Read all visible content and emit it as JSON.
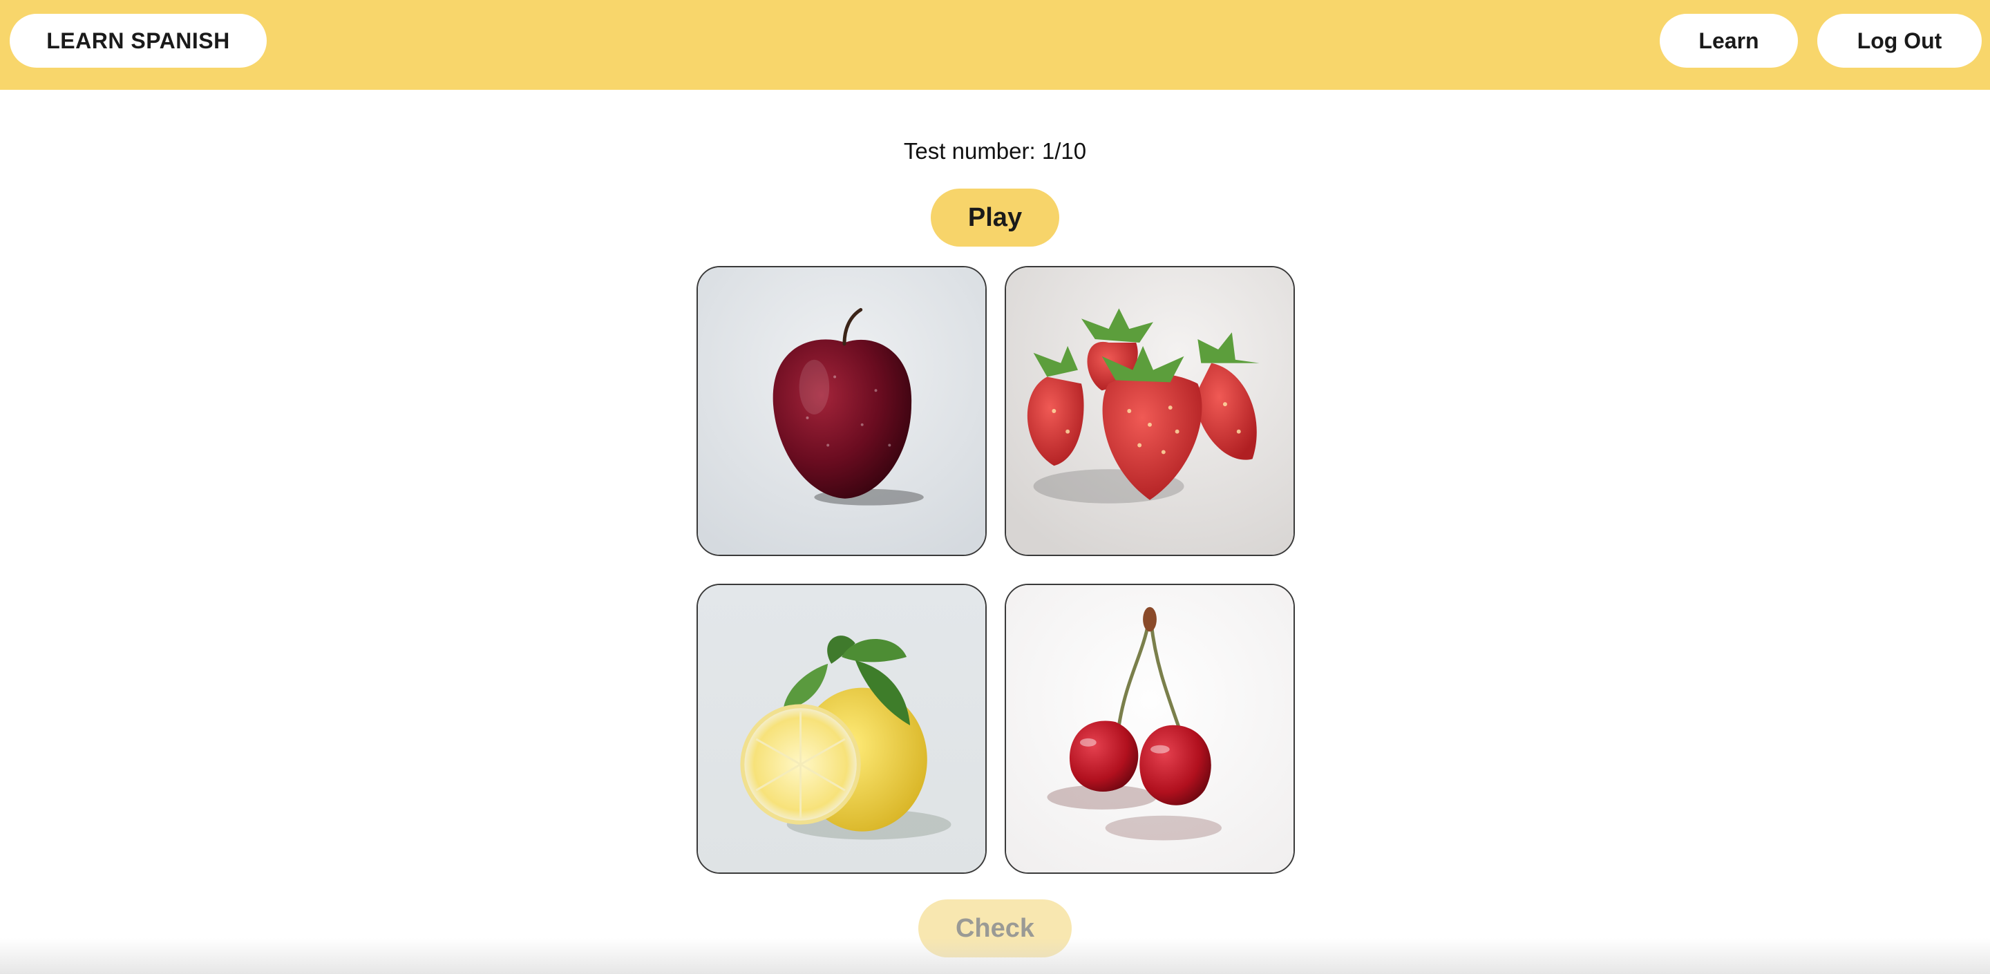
{
  "header": {
    "brand": "LEARN SPANISH",
    "nav": {
      "learn": "Learn",
      "logout": "Log Out"
    },
    "background_color": "#f8d66b"
  },
  "quiz": {
    "counter": "Test number: 1/10",
    "play_label": "Play",
    "check_label": "Check",
    "check_state": "disabled",
    "options": [
      {
        "icon": "apple-icon"
      },
      {
        "icon": "strawberry-icon"
      },
      {
        "icon": "lemon-icon"
      },
      {
        "icon": "cherry-icon"
      }
    ]
  },
  "colors": {
    "accent": "#f7d46a",
    "check_disabled": "#f8e7b0",
    "card_border": "#3a3a3a"
  }
}
